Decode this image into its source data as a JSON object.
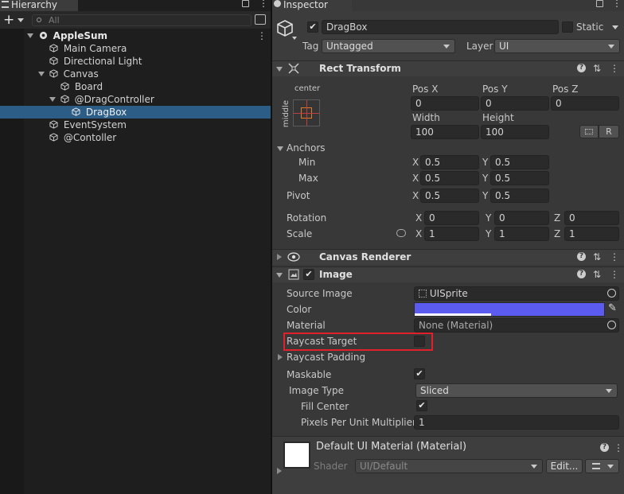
{
  "hierarchy": {
    "tab_label": "Hierarchy",
    "search_placeholder": "All",
    "add_label": "+",
    "items": [
      {
        "label": "AppleSum"
      },
      {
        "label": "Main Camera"
      },
      {
        "label": "Directional Light"
      },
      {
        "label": "Canvas"
      },
      {
        "label": "Board"
      },
      {
        "label": "@DragController"
      },
      {
        "label": "DragBox"
      },
      {
        "label": "EventSystem"
      },
      {
        "label": "@Contoller"
      }
    ]
  },
  "inspector": {
    "tab_label": "Inspector",
    "object_name": "DragBox",
    "static_label": "Static",
    "tag_label": "Tag",
    "tag_value": "Untagged",
    "layer_label": "Layer",
    "layer_value": "UI",
    "rect_transform": {
      "title": "Rect Transform",
      "anchor_h": "center",
      "anchor_v": "middle",
      "pos_x_label": "Pos X",
      "pos_y_label": "Pos Y",
      "pos_z_label": "Pos Z",
      "pos_x": "0",
      "pos_y": "0",
      "pos_z": "0",
      "width_label": "Width",
      "height_label": "Height",
      "width": "100",
      "height": "100",
      "r_label": "R",
      "anchors_label": "Anchors",
      "min_label": "Min",
      "max_label": "Max",
      "min_x": "0.5",
      "min_y": "0.5",
      "max_x": "0.5",
      "max_y": "0.5",
      "pivot_label": "Pivot",
      "pivot_x": "0.5",
      "pivot_y": "0.5",
      "rotation_label": "Rotation",
      "rot_x": "0",
      "rot_y": "0",
      "rot_z": "0",
      "scale_label": "Scale",
      "scale_x": "1",
      "scale_y": "1",
      "scale_z": "1",
      "x": "X",
      "y": "Y",
      "z": "Z"
    },
    "canvas_renderer": {
      "title": "Canvas Renderer"
    },
    "image": {
      "title": "Image",
      "source_image_label": "Source Image",
      "source_image_value": "UISprite",
      "color_label": "Color",
      "color_value": "#5b5bf0",
      "material_label": "Material",
      "material_value": "None (Material)",
      "raycast_target_label": "Raycast Target",
      "raycast_padding_label": "Raycast Padding",
      "maskable_label": "Maskable",
      "image_type_label": "Image Type",
      "image_type_value": "Sliced",
      "fill_center_label": "Fill Center",
      "ppu_label": "Pixels Per Unit Multiplier",
      "ppu_value": "1"
    },
    "material_asset": {
      "title": "Default UI Material (Material)",
      "shader_label": "Shader",
      "shader_value": "UI/Default",
      "edit_label": "Edit..."
    }
  },
  "colors": {
    "selection": "#2c5d87",
    "highlight_box": "#e0202a"
  }
}
